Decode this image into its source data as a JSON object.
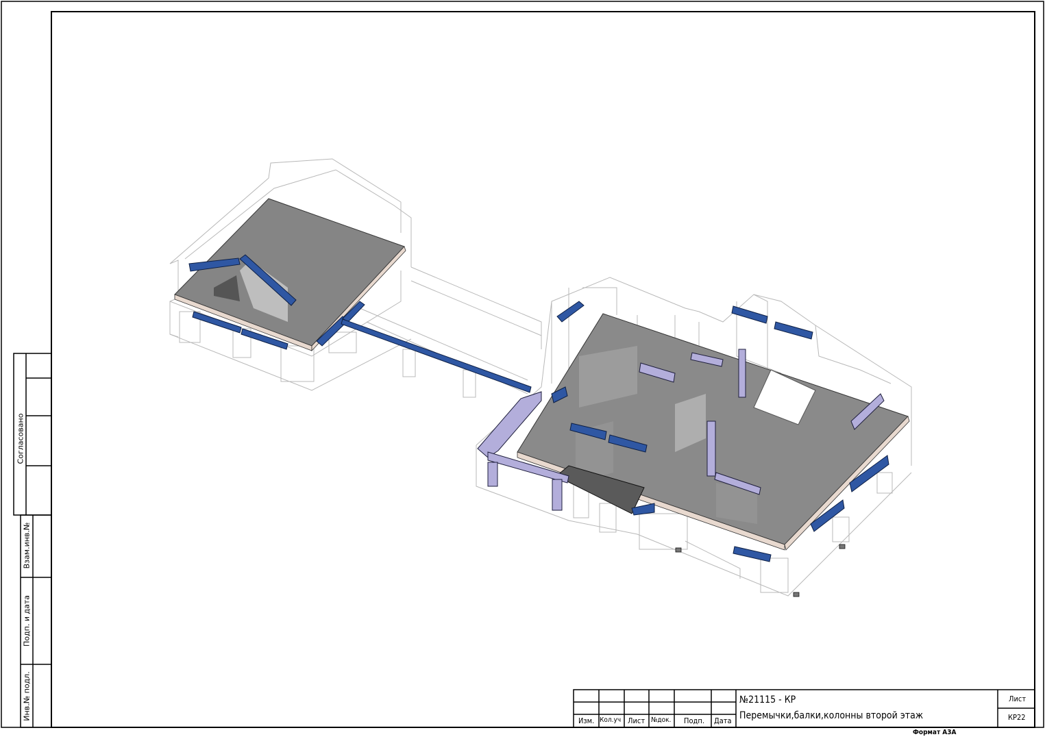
{
  "title_block": {
    "doc_number": "№21115 - КР",
    "sheet_title": "Перемычки,балки,колонны второй этаж",
    "sheet_label": "Лист",
    "sheet_code": "КР22",
    "columns": [
      "Изм.",
      "Кол.уч",
      "Лист",
      "№док.",
      "Подп.",
      "Дата"
    ]
  },
  "side_stamp": {
    "approved": "Согласовано",
    "replaced_inv": "Взам.инв.№",
    "sign_date": "Подп. и дата",
    "inv_original": "Инв.№ подл."
  },
  "format_label": "Формат А3А",
  "colors": {
    "beam_dark": "#2f57a3",
    "beam_light": "#b3aedb",
    "slab": "#7a7a7a",
    "wireframe": "#b8b8b8"
  }
}
